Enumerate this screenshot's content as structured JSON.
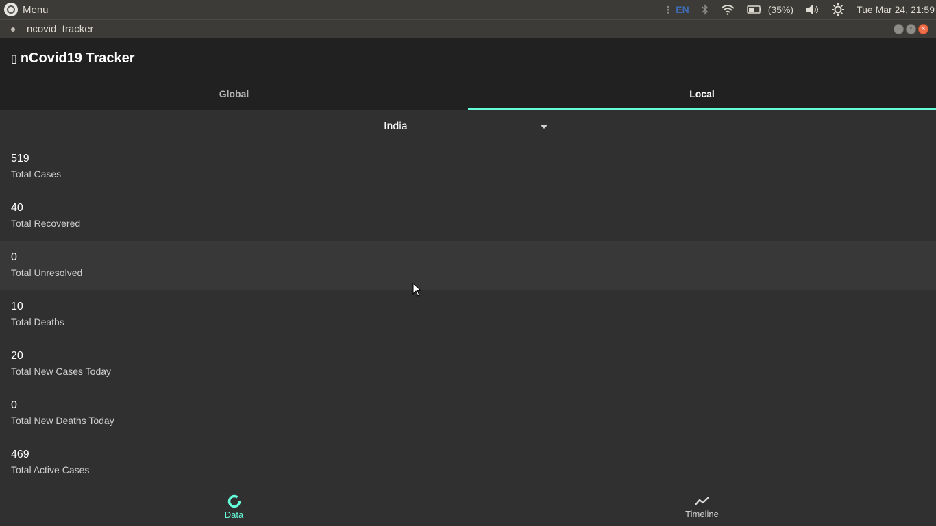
{
  "topbar": {
    "menu_label": "Menu",
    "keyboard_layout": "EN",
    "battery_text": "(35%)",
    "datetime": "Tue Mar 24, 21:59"
  },
  "window": {
    "title": "ncovid_tracker"
  },
  "app": {
    "title": "nCovid19 Tracker",
    "tabs": [
      {
        "label": "Global",
        "active": false
      },
      {
        "label": "Local",
        "active": true
      }
    ],
    "accent_color": "#64ffda"
  },
  "local": {
    "country_selected": "India",
    "stats": [
      {
        "value": "519",
        "label": "Total Cases"
      },
      {
        "value": "40",
        "label": "Total Recovered"
      },
      {
        "value": "0",
        "label": "Total Unresolved"
      },
      {
        "value": "10",
        "label": "Total Deaths"
      },
      {
        "value": "20",
        "label": "Total New Cases Today"
      },
      {
        "value": "0",
        "label": "Total New Deaths Today"
      },
      {
        "value": "469",
        "label": "Total Active Cases"
      }
    ]
  },
  "bottom_nav": {
    "items": [
      {
        "label": "Data",
        "icon": "donut-chart-icon",
        "active": true
      },
      {
        "label": "Timeline",
        "icon": "line-chart-icon",
        "active": false
      }
    ]
  }
}
